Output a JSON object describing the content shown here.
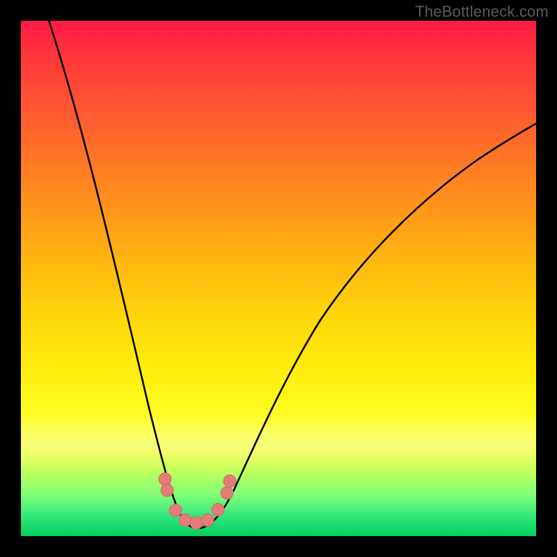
{
  "watermark": "TheBottleneck.com",
  "colors": {
    "frame": "#000000",
    "curve_stroke": "#000000",
    "marker_fill": "#e37d7a",
    "gradient_top": "#ff1a45",
    "gradient_bottom": "#00d060"
  },
  "chart_data": {
    "type": "line",
    "title": "",
    "xlabel": "",
    "ylabel": "",
    "xlim": [
      0,
      100
    ],
    "ylim": [
      0,
      100
    ],
    "grid": false,
    "legend": false,
    "note": "Values read from pixel positions; y=0 at bottom, y=100 at top. Curve is a V-shaped bottleneck profile with minimum near x≈33.",
    "series": [
      {
        "name": "bottleneck-curve",
        "x": [
          5,
          10,
          15,
          20,
          23,
          26,
          28,
          30,
          32,
          34,
          36,
          38,
          40,
          45,
          50,
          55,
          60,
          65,
          70,
          75,
          80,
          85,
          90,
          95,
          100
        ],
        "y": [
          100,
          82,
          64,
          45,
          32,
          20,
          12,
          6,
          3,
          2,
          3,
          6,
          12,
          26,
          38,
          48,
          56,
          62,
          67,
          71,
          74,
          77,
          79,
          81,
          82
        ]
      }
    ],
    "markers": {
      "name": "highlight-points",
      "x": [
        27.5,
        29,
        31,
        33,
        35,
        37,
        38.5
      ],
      "y": [
        12,
        7,
        3.5,
        2.5,
        3.5,
        7,
        12
      ]
    }
  }
}
